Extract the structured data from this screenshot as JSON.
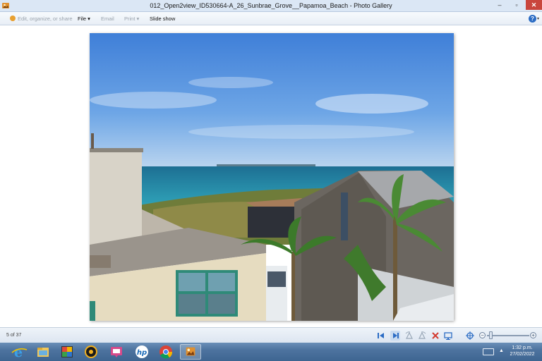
{
  "window": {
    "title": "012_Open2view_ID530664-A_26_Sunbrae_Grove__Papamoa_Beach - Photo Gallery",
    "minimize": "–",
    "maximize": "▫",
    "close": "✕"
  },
  "toolbar": {
    "edit_label": "Edit, organize, or share",
    "file_label": "File ▾",
    "email_label": "Email",
    "print_label": "Print ▾",
    "slideshow_label": "Slide show",
    "help": "?",
    "help_caret": "▾"
  },
  "viewer": {
    "counter": "5 of 37"
  },
  "controls": {
    "zoom_minus": "−",
    "zoom_plus": "+",
    "zoom_level": 0.05
  },
  "taskbar": {
    "apps": [
      "internet-explorer",
      "file-explorer",
      "photo-app",
      "media-player",
      "presentation-app",
      "hp",
      "chrome",
      "photo-gallery"
    ],
    "time": "1:32 p.m.",
    "date": "27/02/2022",
    "tray_up": "▲"
  },
  "colors": {
    "close": "#c9463d",
    "accent": "#2b6cc4"
  }
}
